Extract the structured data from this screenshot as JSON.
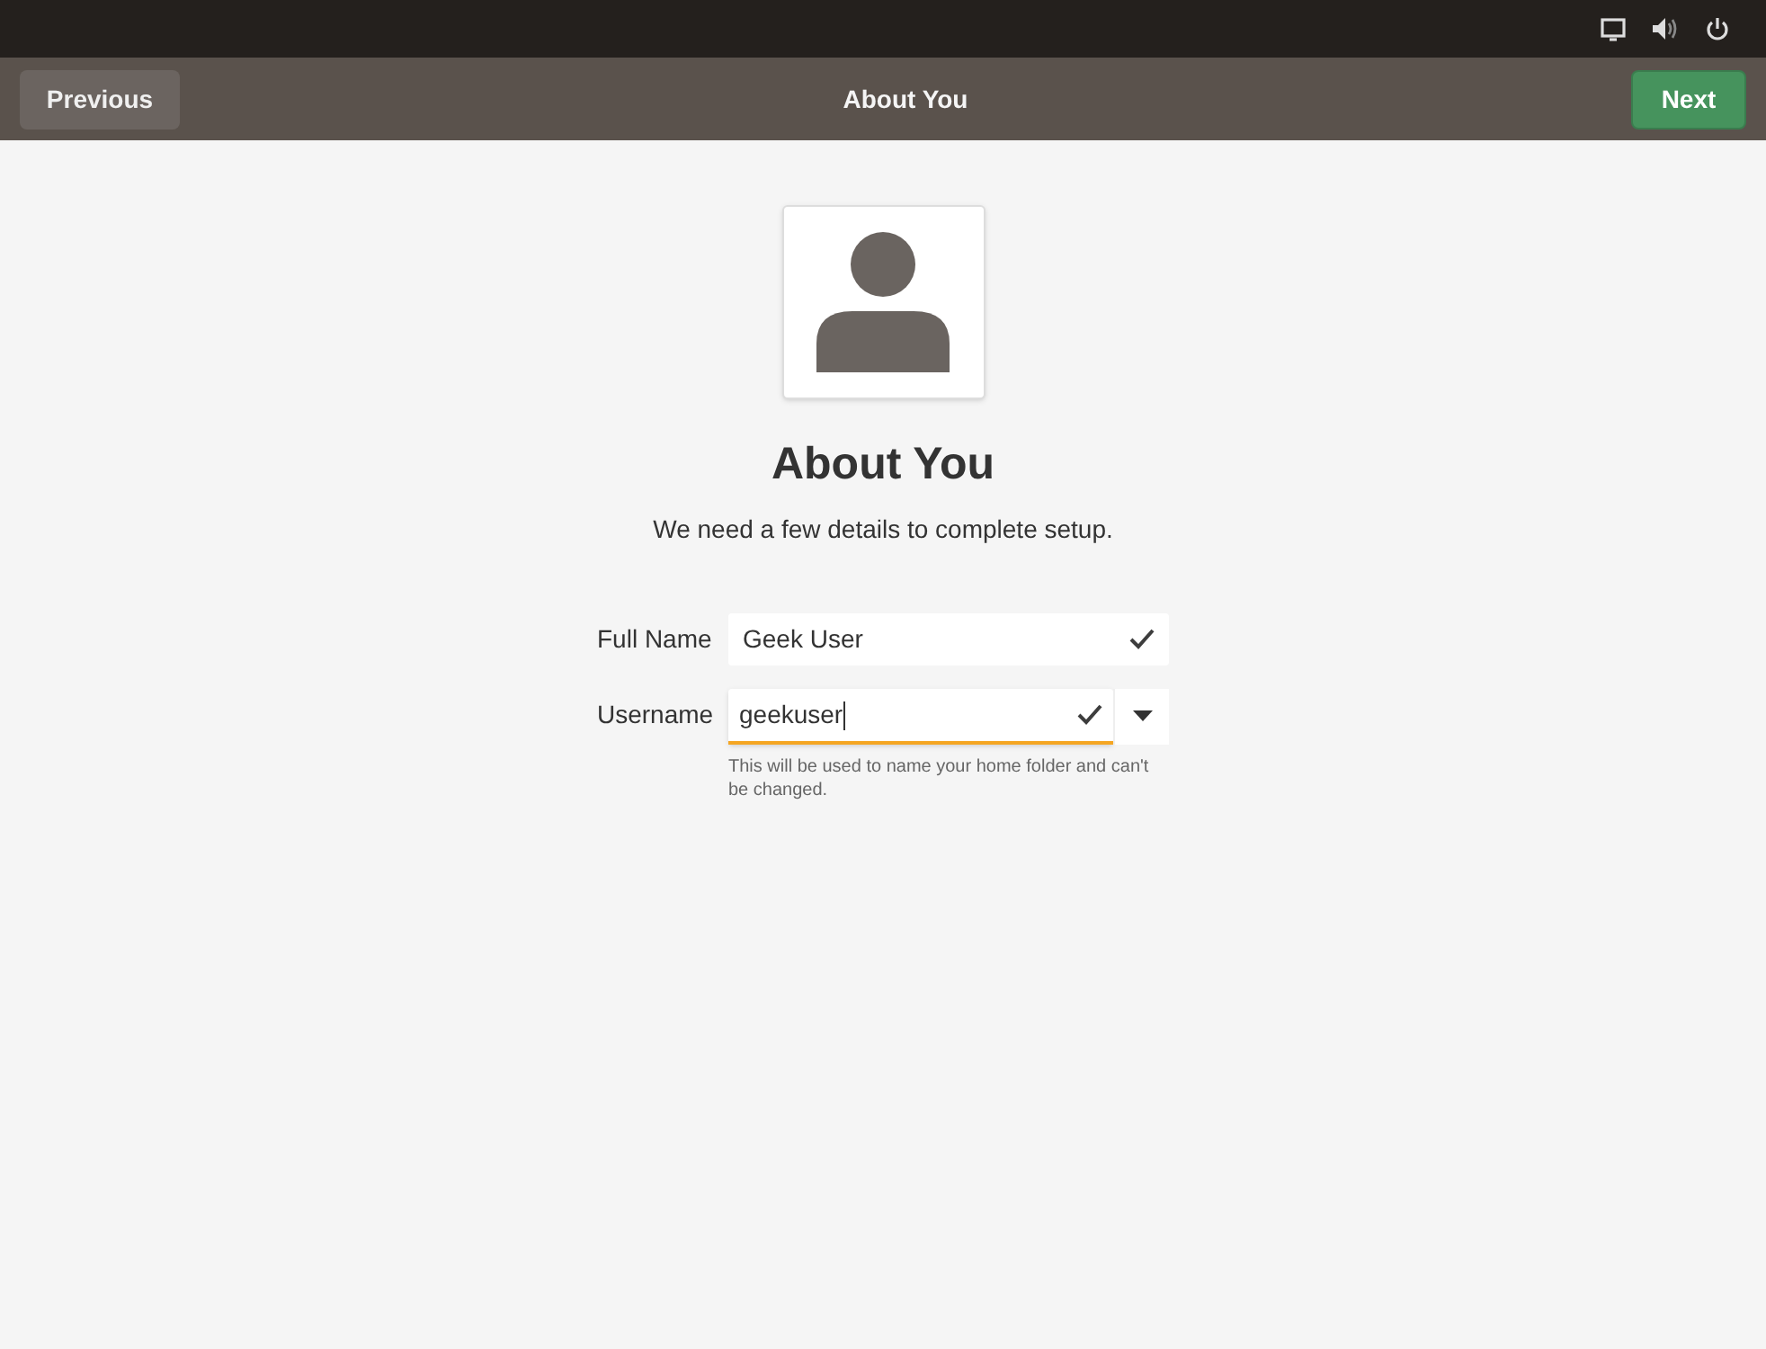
{
  "header": {
    "title": "About You",
    "previous": "Previous",
    "next": "Next"
  },
  "page": {
    "title": "About You",
    "subtitle": "We need a few details to complete setup."
  },
  "fields": [
    {
      "kind": "text",
      "label": "Full Name",
      "value": "Geek User",
      "valid": true,
      "focused": false
    },
    {
      "kind": "combo",
      "label": "Username",
      "value": "geekuser",
      "valid": true,
      "focused": true,
      "hint": "This will be used to name your home folder and can't be changed."
    }
  ]
}
